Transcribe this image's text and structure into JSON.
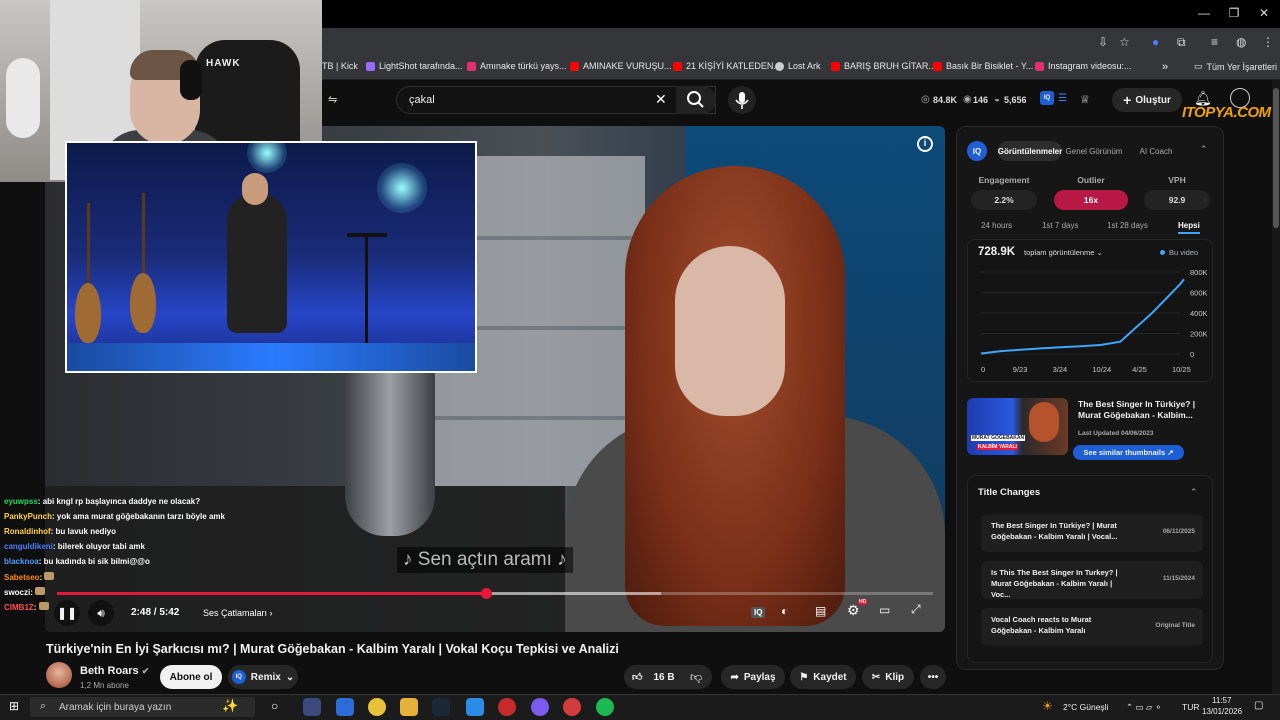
{
  "window": {
    "minimize": "—",
    "maximize": "❐",
    "close": "✕"
  },
  "bookmarks": [
    {
      "label": "TB | Kick",
      "color": "#53fc18"
    },
    {
      "label": "LightShot tarafında...",
      "color": "#9b6bff"
    },
    {
      "label": "Amınake türkü yays...",
      "color": "#e1306c"
    },
    {
      "label": "AMINAKE VURUŞU...",
      "color": "#ff0000"
    },
    {
      "label": "21 KİŞİYİ KATLEDEN...",
      "color": "#ff0000"
    },
    {
      "label": "Lost Ark",
      "color": "#cccccc"
    },
    {
      "label": "BARIŞ BRUH GİTAR...",
      "color": "#ff0000"
    },
    {
      "label": "Basık Bir Bisiklet - Y...",
      "color": "#ff0000"
    },
    {
      "label": "Instagram videosu:...",
      "color": "#e1306c"
    },
    {
      "label": "»",
      "color": ""
    },
    {
      "label": "Tüm Yer İşaretleri",
      "color": ""
    }
  ],
  "header": {
    "search_value": "çakal",
    "stats": [
      "84.8K",
      "146",
      "5,656"
    ],
    "create_label": "Oluştur",
    "sponsor": "ITOPYA.COM"
  },
  "video": {
    "subtitle": "♪ Sen açtın aramı ♪",
    "time": "2:48 / 5:42",
    "chapter": "Ses Çatlamaları",
    "progress_fraction": 0.49,
    "buffer_fraction": 0.69,
    "hd_badge": "HD"
  },
  "webcam": {
    "chair_brand": "HAWK"
  },
  "chat": [
    {
      "user": "eyuwpss",
      "color": "#1ed760",
      "msg": "abi kngl rp başlayınca daddye ne olacak?"
    },
    {
      "user": "PankyPunch",
      "color": "#ffd23f",
      "msg": "yok ama murat göğebakanın tarzı böyle amk"
    },
    {
      "user": "Ronaldinhof",
      "color": "#ffd23f",
      "msg": "bu lavuk nediyo"
    },
    {
      "user": "canguldikeni",
      "color": "#4a7dff",
      "msg": "bilerek oluyor tabi amk"
    },
    {
      "user": "blacknoa",
      "color": "#4a9dff",
      "msg": "bu kadında bi sik bilmi@@o"
    },
    {
      "user": "Sabetseo",
      "color": "#ff8c00",
      "msg": ""
    },
    {
      "user": "swoczi",
      "color": "#ffffff",
      "msg": ""
    },
    {
      "user": "CIMB1Z",
      "color": "#ff4d4d",
      "msg": ""
    }
  ],
  "below": {
    "title": "Türkiye'nin En İyi Şarkıcısı mı? | Murat Göğebakan - Kalbim Yaralı | Vokal Koçu Tepkisi ve Analizi",
    "channel": "Beth Roars",
    "subscribers": "1,2 Mn abone",
    "subscribe": "Abone ol",
    "remix": "Remix",
    "likes": "16 B",
    "share": "Paylaş",
    "save": "Kaydet",
    "clip": "Klip",
    "more": "•••"
  },
  "panel": {
    "badge": "IQ",
    "tabs": [
      "Görüntülenmeler",
      "Genel Görünüm",
      "AI Coach"
    ],
    "metrics": [
      {
        "label": "Engagement",
        "value": "2.2%"
      },
      {
        "label": "Outlier",
        "value": "16x"
      },
      {
        "label": "VPH",
        "value": "92.9"
      }
    ],
    "ranges": [
      "24 hours",
      "1st 7 days",
      "1st 28 days",
      "Hepsi"
    ],
    "total_views": "728.9K",
    "metric_select": "toplam görüntülenme",
    "legend": "Bu video",
    "thumb_title": "The Best Singer In Türkiye? | Murat Göğebakan - Kalbim...",
    "last_updated": "Last Updated 04/06/2023",
    "similar": "See similar thumbnails",
    "thumb_overlay": "MURAT GÖĞEBAKAN",
    "thumb_overlay2": "KALBİM YARALI",
    "title_changes_heading": "Title Changes",
    "title_changes": [
      {
        "title": "The Best Singer In Türkiye? | Murat Göğebakan - Kalbim Yaralı | Vocal...",
        "date": "06/11/2025"
      },
      {
        "title": "Is This The Best Singer In Turkey? | Murat Göğebakan - Kalbim Yaralı | Voc...",
        "date": "11/15/2024"
      },
      {
        "title": "Vocal Coach reacts to Murat Göğebakan - Kalbim Yaralı",
        "date": "Original Title"
      }
    ]
  },
  "chart_data": {
    "type": "line",
    "x": [
      "0",
      "9/23",
      "3/24",
      "10/24",
      "4/25",
      "10/25"
    ],
    "ytick_labels": [
      "800K",
      "600K",
      "400K",
      "200K",
      "0"
    ],
    "ylim": [
      0,
      800000
    ],
    "series": [
      {
        "name": "Bu video",
        "points": [
          [
            0,
            5000
          ],
          [
            0.5,
            28000
          ],
          [
            1,
            42000
          ],
          [
            1.5,
            55000
          ],
          [
            2,
            65000
          ],
          [
            2.5,
            75000
          ],
          [
            3,
            88000
          ],
          [
            3.5,
            120000
          ],
          [
            3.9,
            260000
          ],
          [
            4.3,
            400000
          ],
          [
            4.7,
            560000
          ],
          [
            5.0,
            680000
          ],
          [
            5.1,
            728900
          ]
        ]
      }
    ],
    "color": "#3ea6ff"
  },
  "taskbar": {
    "search_placeholder": "Aramak için buraya yazın",
    "weather": "2°C Güneşli",
    "lang": "TUR",
    "time": "11:57",
    "date": "13/01/2026"
  }
}
